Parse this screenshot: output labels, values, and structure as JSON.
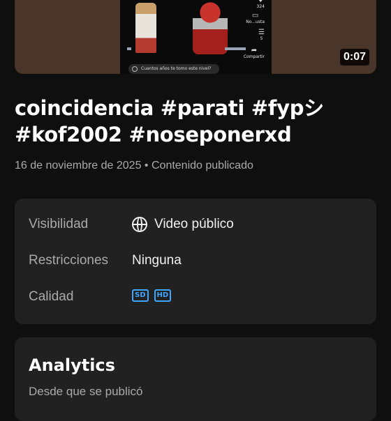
{
  "thumbnail": {
    "duration": "0:07",
    "side_actions": [
      {
        "glyph": "♥",
        "label": "324"
      },
      {
        "glyph": "▭",
        "label": "No...usta"
      },
      {
        "glyph": "☰",
        "label": "5"
      },
      {
        "glyph": "➦",
        "label": "Compartir"
      }
    ],
    "comment_prompt": "Cuantos años te tomo este nivel?"
  },
  "video": {
    "title_line1": "coincidencia  #parati #fypシ",
    "title_line2": "#kof2002 #noseponerxd",
    "date": "16 de noviembre de 2025",
    "separator": "•",
    "status": "Contenido publicado"
  },
  "details": {
    "visibility_label": "Visibilidad",
    "visibility_value": "Video público",
    "restrictions_label": "Restricciones",
    "restrictions_value": "Ninguna",
    "quality_label": "Calidad",
    "quality_badges": [
      "SD",
      "HD"
    ],
    "accent_color": "#3ea6ff"
  },
  "analytics": {
    "title": "Analytics",
    "subtitle": "Desde que se publicó"
  }
}
